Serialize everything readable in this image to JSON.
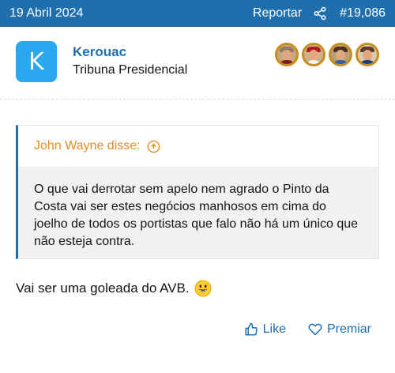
{
  "post": {
    "date": "19 Abril 2024",
    "report_label": "Reportar",
    "share_icon": "share-icon",
    "post_number": "#19,086"
  },
  "author": {
    "avatar_letter": "K",
    "name": "Kerouac",
    "title": "Tribuna Presidencial",
    "avatar_color": "#29a8ef",
    "trophies": [
      "trophy-badge-1",
      "trophy-badge-2",
      "trophy-badge-3",
      "trophy-badge-4"
    ]
  },
  "quote": {
    "header": "John Wayne disse:",
    "header_icon": "arrow-up-circle-icon",
    "text": "O que vai derrotar sem apelo nem agrado o Pinto da Costa vai ser estes negócios manhosos em cima do joelho de todos os portistas que falo não há um único que não esteja contra."
  },
  "message": {
    "text": "Vai ser uma goleada do AVB.",
    "emoji": "grinning-face-emoji"
  },
  "actions": {
    "like_label": "Like",
    "like_icon": "thumbs-up-icon",
    "award_label": "Premiar",
    "award_icon": "heart-icon"
  },
  "colors": {
    "header_bar": "#1f6fae",
    "link_blue": "#1f6fae",
    "quote_author": "#e08d22",
    "quote_background": "#f1f1f1"
  }
}
